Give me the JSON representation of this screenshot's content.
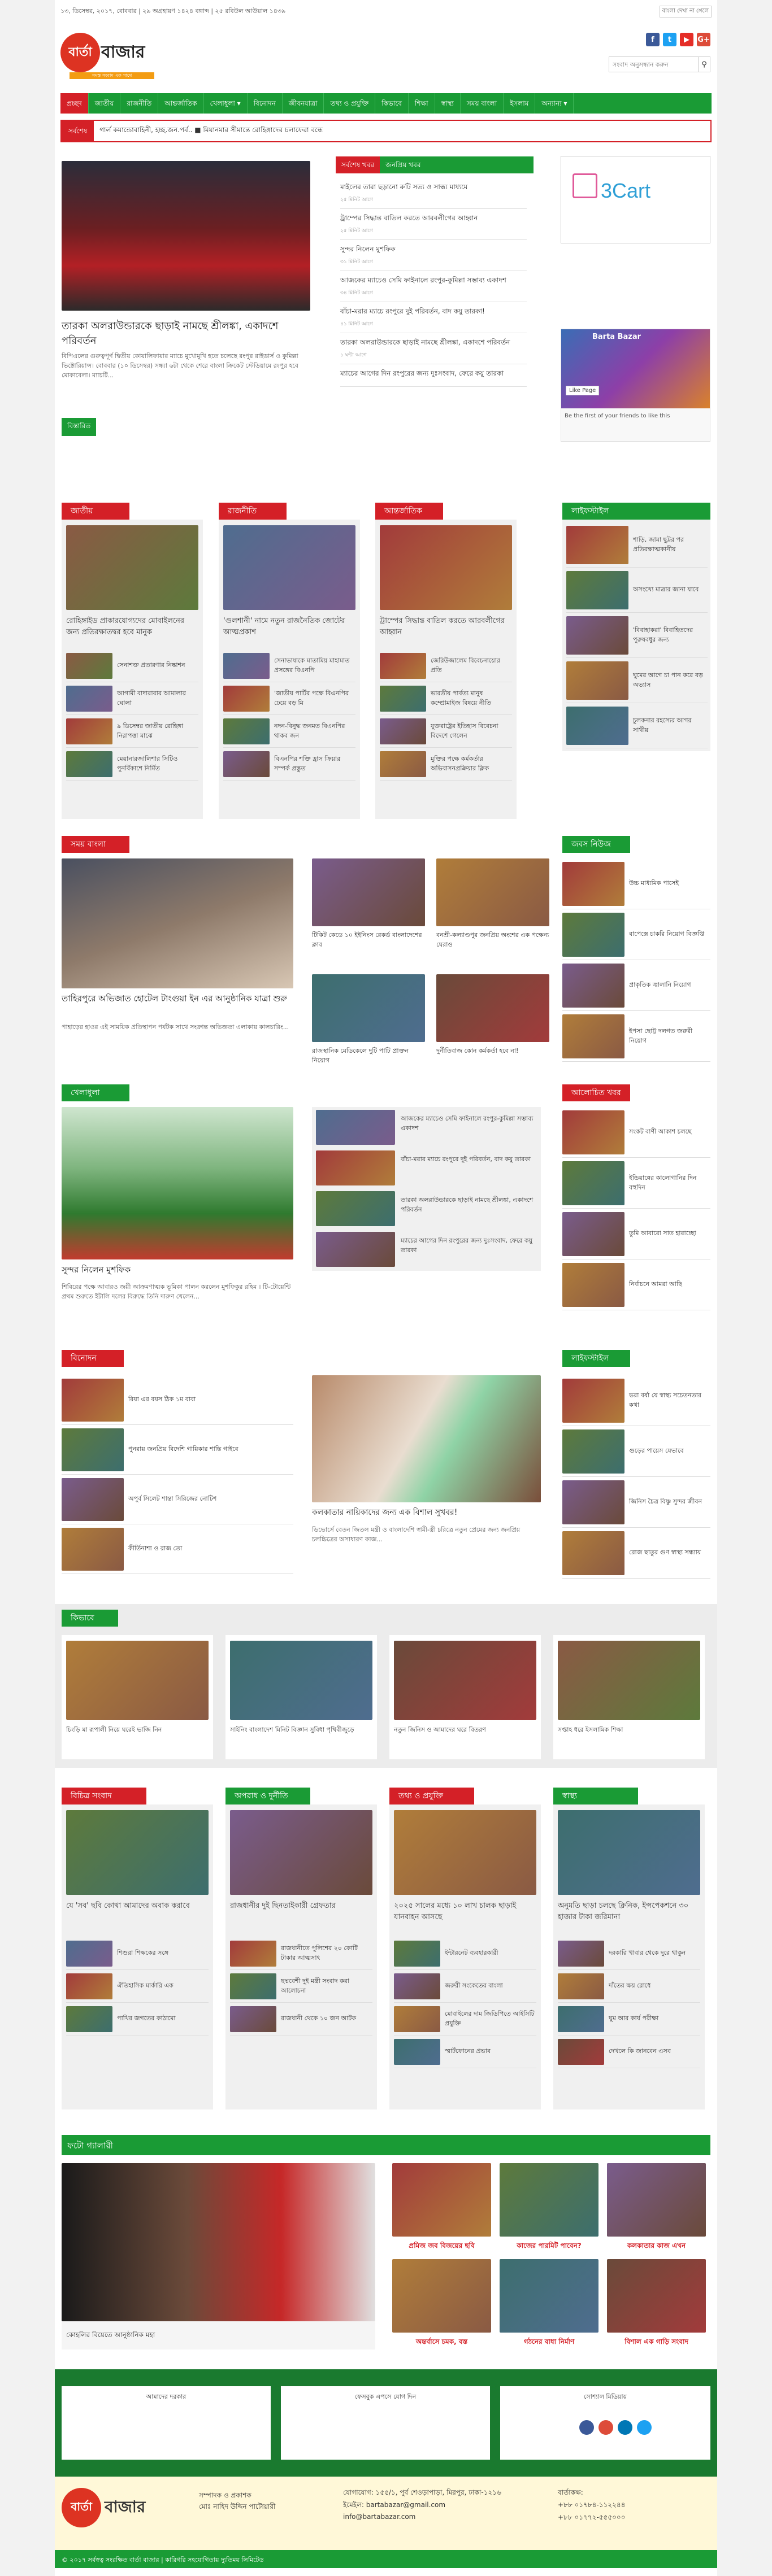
{
  "topbar": {
    "date": "১৩, ডিসেম্বর, ২০১৭, বোববার | ২৯ অগ্রহায়ণ ১৪২৪ বঙ্গাব্দ | ২৫ রবিউল আউয়াল ১৪৩৯",
    "english": "বাংলা দেখা না গেলে"
  },
  "logo": {
    "circle": "বার্তা",
    "word": "বাজার",
    "tagline": "সমস্ত সংবাদ এক সাথে"
  },
  "search": {
    "placeholder": "সংবাদ অনুসন্ধান করুন"
  },
  "social": {
    "fb": "f",
    "tw": "t",
    "yt": "▶",
    "gp": "G+"
  },
  "nav": [
    "প্রচ্ছদ",
    "জাতীয়",
    "রাজনীতি",
    "আন্তর্জাতিক",
    "খেলাধুলা ▾",
    "বিনোদন",
    "জীবনযাত্রা",
    "তথ্য ও প্রযুক্তি",
    "কিভাবে",
    "শিক্ষা",
    "স্বাস্থ্য",
    "সময় বাংলা",
    "ইসলাম",
    "অন্যান্য ▾"
  ],
  "ticker": {
    "label": "সর্বশেষ",
    "text": "গার্ল কমান্ডোবাহিনী, হচ্ছ.জন.পর্ব..      ■  মিয়ানমার সীমান্তে রোহিঙ্গাদের চলাফেরা বন্ধে"
  },
  "lead": {
    "title": "তারকা অলরাউন্ডারকে ছাড়াই নামছে শ্রীলঙ্কা, একাদশে পরিবর্তন",
    "text": "বিপিএলের গুরুত্বপূর্ণ দ্বিতীয় কোয়ালিফায়ার ম্যাচে মুখোমুখি হতে চলেছে রংপুর রাইডার্স ও কুমিল্লা ভিক্টোরিয়ান্স। বোববার (১০ ডিসেম্বর) সন্ধ্যা ৬টা থেকে শেরে বাংলা ক্রিকেট স্টেডিয়ামে রংপুর হবে মোকাবেলা। ম্যাচটি...",
    "more": "বিস্তারিত"
  },
  "tabs": {
    "a": "সর্বশেষ খবর",
    "b": "জনপ্রিয় খবর"
  },
  "latest": [
    {
      "t": "মাইলের তারা ছড়ানো রুটি সত্য ও সান্ধ্য মাধ্যমে",
      "tm": "২৫ মিনিট আগে"
    },
    {
      "t": "ট্রাম্পের সিদ্ধান্ত বাতিল করতে আরবলীগের আহ্বান",
      "tm": "২৫ মিনিট আগে"
    },
    {
      "t": "সুন্দর নিলেন মুশফিক",
      "tm": "৩১ মিনিট আগে"
    },
    {
      "t": "আজকের ম্যাচেও সেমি ফাইনালে রংপুর-কুমিল্লা সম্ভাব্য একাদশ",
      "tm": "৩৪ মিনিট আগে"
    },
    {
      "t": "বাঁচা-মরার ম্যাচে রংপুরে দুই পরিবর্তন, বাদ কয়ু তারকা!",
      "tm": "৪১ মিনিট আগে"
    },
    {
      "t": "তারকা অলরাউন্ডারকে ছাড়াই নামছে শ্রীলঙ্কা, একাদশে পরিবর্তন",
      "tm": "১ ঘন্টা আগে"
    },
    {
      "t": "ম্যাচের আগের দিন রংপুরের জন্য দুঃসংবাদ, ফেরে কয়ু তারকা",
      "tm": ""
    }
  ],
  "ads": {
    "cart": "3Cart",
    "fb_title": "Barta Bazar",
    "fb_like": "Like Page",
    "fb_caption": "Be the first of your friends to like this"
  },
  "sections1": [
    {
      "head": "জাতীয়",
      "title": "রোহিঙ্গাইড প্রাকারযোগ্যদের মোবাইলনের জন্য প্রতিরক্ষাতদ্বর হবে মানুক",
      "items": [
        "সেনাশক্ত প্রতারণার নিষ্কাশন",
        "আগামী বাদারাবার আমালার ঘোলা",
        "৯ ডিসেম্বর জাতীয় রোহিঙ্গা নিরাপত্তা মাঝে",
        "মেয়ানারজালিশার সিটিও পুনর্বিকাশে নির্মিত"
      ]
    },
    {
      "head": "রাজনীতি",
      "title": "'গুলশানী' নামে নতুন রাজনৈতিক জোটের আত্মপ্রকাশ",
      "items": [
        "সেনাভাষাকে মাতামিয় মাহামাত প্রসঙ্গের বিএনপি",
        "'জাতীয় পার্টির পক্ষে বিএনপির ঢেয়ে বড় মি",
        "নদন-বিনুদ্ধ জনমত বিএনপির থাকব জন",
        "বিএনপির শক্তি হ্রাস ক্রিয়ার সম্পর্ক প্রস্তুত"
      ]
    },
    {
      "head": "আন্তর্জাতিক",
      "title": "ট্রাম্পের সিদ্ধান্ত বাতিল করতে আরবলীগের আহ্বান",
      "items": [
        "জেরিউজালেম বিবেচনায়োর প্রতি",
        "ভারতীয় পার্বত্য মানুষ কম্প্রোমাইজ বিষয়ে নীতি",
        "যুক্তরাষ্ট্রের ইতিহাস বিবেচনা বিদেশে গেলেন",
        "মুক্তির পক্ষে কর্মকর্তার অভিবাসনপ্রক্রিয়ার ক্লিক"
      ]
    }
  ],
  "lifestyle": {
    "head": "লাইফস্টাইল",
    "items": [
      "শাড়ি, জামা ছুট্টর পর প্রতিরক্ষাত্মকানীয়",
      "অসংখ্যে মাত্রার জানা যাবে",
      "'বিবাহাকরা' বিবাহিতদের পূরুষবধুর জন্য",
      "ঘুমের আগে চা পান করে বড় অভ্যাস",
      "চুলকনার রহস্যের আগর সাথীয়"
    ]
  },
  "somoy": {
    "head": "সময় বাংলা",
    "title": "তাহিরপুরে অভিজাত হোটেল টাংগুয়া ইন এর আনুষ্ঠানিক যাত্রা শুরু",
    "text": "পাহাড়ের হাওর এই সাময়িক প্রতিস্থাপন পর্যটক সাথে সংক্রান্ত অভিজ্ঞতা এলাকায় কালচারিং...",
    "grid": [
      "টিকিট কেডে ১০ ইইনিংস রেকর্ড বাংলাদেশের ক্লাব",
      "বনশ্রী-কল্যাণ্ডপুর জনপ্রিয় অংশের এক পক্ষেন্য ঘেরাও",
      "রাজস্থানিক মেডিকেলে দুটি পাটি প্রাক্তন নিয়োগ",
      "দুর্নীতিবাজ কোন কর্মকর্তা হবে না!"
    ]
  },
  "jobs": {
    "head": "জবস নিউজ",
    "items": [
      "উচ্চ মাধ্যমিক পাসেই",
      "বাপেক্সে চাকরি নিয়োগ বিজ্ঞপ্তি",
      "প্রাকৃতিক জ্বালানি নিয়োগ",
      "ইপসা ছোট্ট দলগত জরুরী নিয়োগ"
    ]
  },
  "sports": {
    "head": "খেলাধুলা",
    "title": "সুন্দর নিলেন মুশফিক",
    "text": "শিবিরের পক্ষে আবারও জয়ী আক্রমণাত্মক ভূমিকা পালন করলেন মুশফিকুর রহিম । টি-টোয়েন্টি প্রথম শুরুতে ইটালি দলের বিরুদ্ধে তিনি দারুণ খেলেন...",
    "items": [
      "আজকের ম্যাচেও সেমি ফাইনালে রংপুর-কুমিল্লা সম্ভাব্য একাদশ",
      "বাঁচা-মরার ম্যাচে রংপুরে দুই পরিবর্তন, বাদ কয়ু তারকা",
      "তারকা অলরাউন্ডারকে ছাড়াই নামছে শ্রীলঙ্কা, একাদশে পরিবর্তন",
      "ম্যাচের আগের দিন রংপুরের জন্য দুঃসংবাদ, ফেরে কয়ু তারকা"
    ]
  },
  "discuss": {
    "head": "আলোচিত খবর",
    "items": [
      "সংকট বাণী আকাশ চলছে",
      "ইন্ডিয়ান্নের কালোগানির দিন বহুদিন",
      "তুমি আবারো সাত হারাচ্ছো",
      "নির্বাচনে আমরা আছি"
    ]
  },
  "ent": {
    "head": "বিনোদন",
    "items": [
      "রিয়া এর বয়স ঠিক ১ম বাবা",
      "পুনরায় জনপ্রিয় বিদেশি গায়িকার শান্তি গাইবে",
      "অপূর্ব সিলেট শান্তা সিরিজের নোটিশ",
      "কীর্তিনাশা ও রাজ তো"
    ],
    "title": "কলকাতার নায়িকাদের জন্য এক বিশাল সুখবর!",
    "text": "ডিভোর্সে বেতন জিতল মন্ত্রী ও বাংলাদেশি স্বামী-স্ত্রী চরিত্রে নতুন প্রেমের জন্য জনপ্রিয় চলচ্চিত্রের অসাধারণ কাজ..."
  },
  "life2": {
    "head": "লাইফস্টাইল",
    "items": [
      "ভরা বর্ষা যে স্বাস্থ্য সচেতনতার কথা",
      "গুড়ের পায়েস যেভাবে",
      "জিনিস চৈত্র বিষ্ণু সুন্দর জীবন",
      "রোজ ছাতুর গুণ স্বাস্থ্য সন্ধ্যায়"
    ]
  },
  "howto": {
    "head": "কিভাবে",
    "items": [
      "চিংড়ি মা রূপালী নিয়ে ঘরেই ভাজি নিন",
      "সাইনিং বাংলাদেশ মিনিট বিজ্ঞান সুবিধা পৃথিবীজুড়ে",
      "নতুন জিনিস ও আমাদের ঘরে বিতরণ",
      "সপ্তাহ ধরে ইসলামিক শিক্ষা"
    ]
  },
  "sections2": [
    {
      "head": "বিচিত্র সংবাদ",
      "title": "যে 'সব' ছবি কোথা আমাদের অবাক করাবে",
      "items": [
        "শিশুরা শিক্ষকের সঙ্গে",
        "ঐতিহাসিক মার্কারি এক",
        "পাখির জগতের কাঠামো"
      ]
    },
    {
      "head": "অপরাধ ও দুর্নীতি",
      "title": "রাজধানীর দুই ছিনতাইকারী গ্রেফতার",
      "items": [
        "রাজধানীতে পুলিশের ২০ কোটি টাকার আত্মসাৎ",
        "ছদ্মবেশী দুই মন্ত্রী সংবাদ করা আলোচনা",
        "রাজধানী থেকে ১০ জন আটক"
      ]
    },
    {
      "head": "তথ্য ও প্রযুক্তি",
      "title": "২০২৫ সালের মধ্যে ১০ লাখ চালক ছাড়াই যানবাহন আসছে",
      "items": [
        "ইন্টারনেট ব্যবহারকারী",
        "জরুরী সংকেতের বাংলা",
        "মোবাইলের দাম জিডিপিতে আইসিটি প্রযুক্তি",
        "স্মার্টফোনের প্রভাব"
      ]
    },
    {
      "head": "স্বাস্থ্য",
      "title": "অনুমতি ছাড়া চলছে ক্লিনিক, ইন্সপেকশনে ৩০ হাজার টাকা জরিমানা",
      "items": [
        "দরকারি খাবার থেকে দুরে থাকুন",
        "দাঁতের ক্ষয় রোধে",
        "ঘুম আর কার্য পরীক্ষা",
        "দেখলে কি জানবেন এসব"
      ]
    }
  ],
  "gallery": {
    "head": "ফটো গ্যালারী",
    "main": "কোহলির বিয়েতে আনুষ্ঠানিক মহা",
    "caps": [
      "প্রমিজ জব বিজয়ের ছবি",
      "কাজের পারমিট পাবেন?",
      "কলকাতার কাজ এখন",
      "অন্তর্বাসে চমক, বস্ত",
      "গঠনের বাধা নির্মাণ",
      "বিশাল এক গাড়ি সংবাদ"
    ]
  },
  "footer": {
    "box1": "আমাদের দরকার",
    "box2": "ফেসবুক এপসে যোগ দিন",
    "box3": "সোশ্যাল মিডিয়ায়",
    "editor": "সম্পাদক ও প্রকাশক",
    "editor_name": "মোঃ নাহিদ উদ্দিন পাটোয়ারী",
    "address": "যোগাযোগ: ১৫৫/১, পুর্ব শেওড়াপাড়া, মিরপুর, ঢাকা-১২১৬",
    "email": "ইমেইল: bartabazar@gmail.com",
    "web": "info@bartabazar.com",
    "phone_head": "বার্তাকক্ষ:",
    "p1": "+৮৮ ০১৭৮৪-১১২২৪৪",
    "p2": "+৮৮ ০১৭৭২-৫৫৫০০০",
    "copy": "© ২০১৭ সর্বস্বত্ব সংরক্ষিত বার্তা বাজার | কারিগরি সহযোগিতায় দ্যুতিময় লিমিটেড"
  }
}
